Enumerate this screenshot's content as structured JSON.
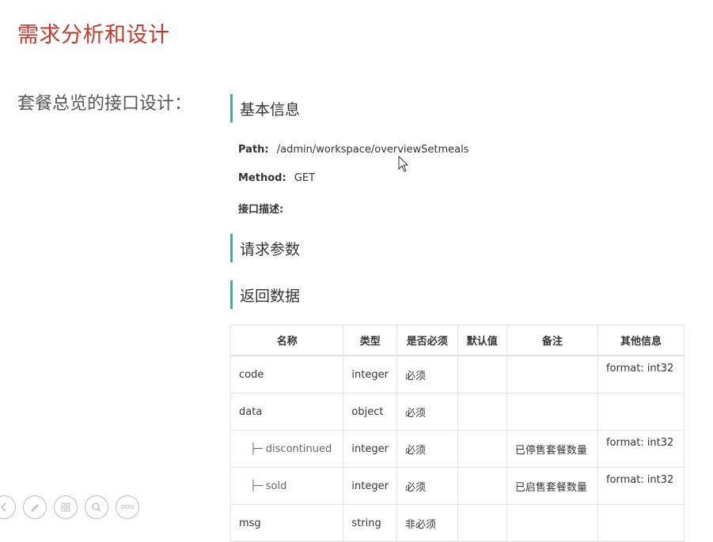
{
  "slide": {
    "title": "需求分析和设计",
    "left_label": "套餐总览的接口设计："
  },
  "sections": {
    "basic_info": "基本信息",
    "request_params": "请求参数",
    "response_data": "返回数据"
  },
  "basic": {
    "path_label": "Path:",
    "path_value": "/admin/workspace/overviewSetmeals",
    "method_label": "Method:",
    "method_value": "GET",
    "desc_label": "接口描述:"
  },
  "table": {
    "headers": [
      "名称",
      "类型",
      "是否必须",
      "默认值",
      "备注",
      "其他信息"
    ],
    "rows": [
      {
        "name": "code",
        "type": "integer",
        "required": "必须",
        "default": "",
        "note": "",
        "info": "format: int32"
      },
      {
        "name": "data",
        "type": "object",
        "required": "必须",
        "default": "",
        "note": "",
        "info": ""
      },
      {
        "name": "├─ discontinued",
        "type": "integer",
        "required": "必须",
        "default": "",
        "note": "已停售套餐数量",
        "info": "format: int32"
      },
      {
        "name": "├─ sold",
        "type": "integer",
        "required": "必须",
        "default": "",
        "note": "已启售套餐数量",
        "info": "format: int32"
      },
      {
        "name": "msg",
        "type": "string",
        "required": "非必须",
        "default": "",
        "note": "",
        "info": ""
      }
    ]
  },
  "toolbar": {
    "icons": [
      "prev-icon",
      "pen-icon",
      "slides-icon",
      "zoom-icon",
      "more-icon"
    ],
    "more_glyph": "ooo"
  },
  "colors": {
    "title": "#c0392b",
    "accent": "#26b99a"
  }
}
